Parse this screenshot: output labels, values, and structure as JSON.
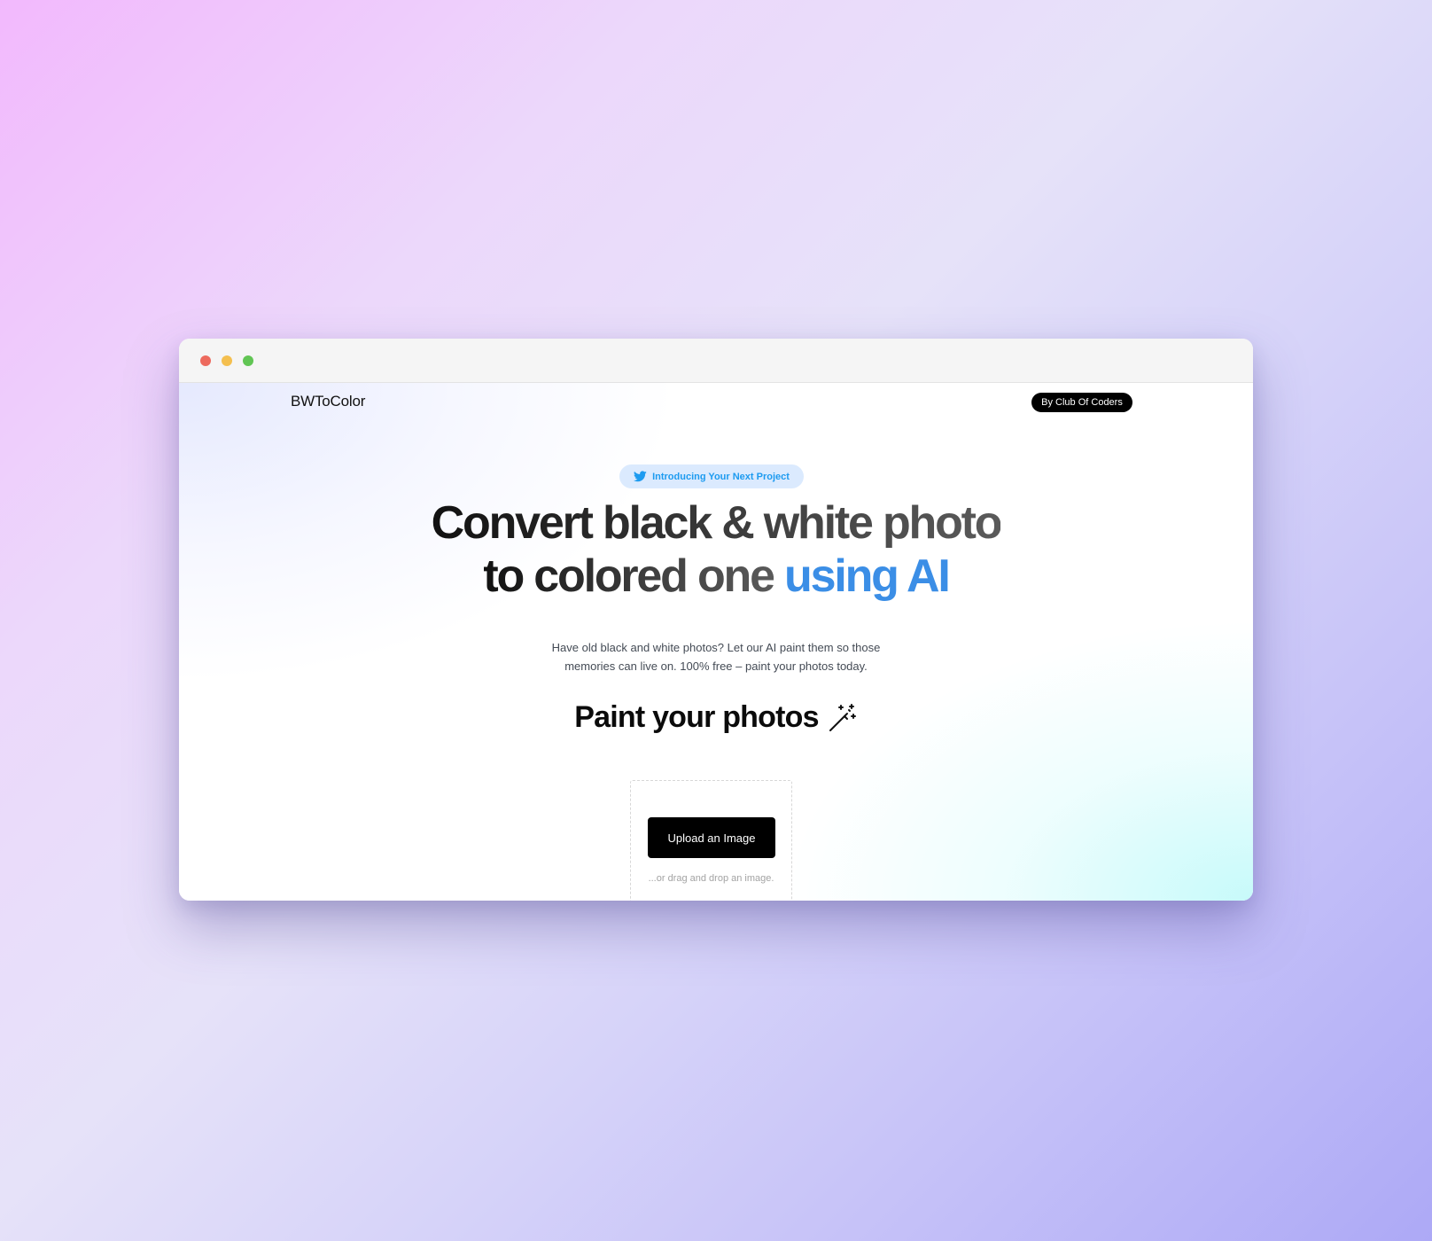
{
  "window": {
    "controls": [
      "close",
      "minimize",
      "zoom"
    ]
  },
  "header": {
    "brand": "BWToColor",
    "badge": "By Club Of Coders"
  },
  "hero": {
    "intro_pill": {
      "icon": "twitter-icon",
      "label": "Introducing Your Next Project"
    },
    "headline_line1": "Convert black & white photo",
    "headline_line2_prefix": "to colored one",
    "headline_line2_accent": "using AI",
    "subtext_line1": "Have old black and white photos? Let our AI paint them so those",
    "subtext_line2": "memories can live on. 100% free – paint your photos today."
  },
  "paint": {
    "heading": "Paint your photos",
    "icon": "magic-wand-icon"
  },
  "upload": {
    "button_label": "Upload an Image",
    "hint": "...or drag and drop an image."
  },
  "colors": {
    "accent": "#3b8ee6",
    "twitter_blue": "#1d9bf0",
    "pill_bg": "#dbeafe",
    "button_bg": "#000000"
  }
}
